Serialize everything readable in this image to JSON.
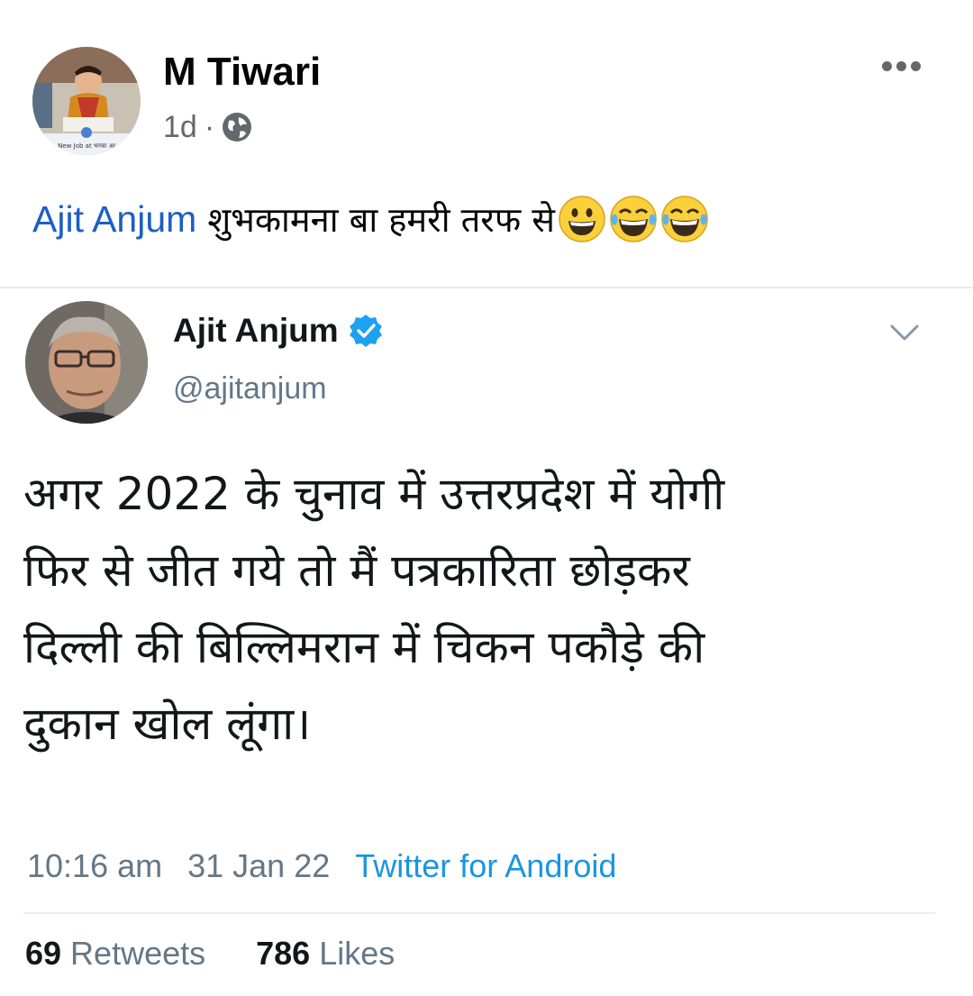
{
  "post": {
    "author_name": "M Tiwari",
    "time": "1d",
    "separator": "·",
    "avatar_banner_text": "New Job at भगवा आ",
    "caption_mention": "Ajit Anjum",
    "caption_text": "शुभकामना बा हमरी तरफ से",
    "caption_emojis": [
      "grinning-face",
      "face-with-tears-of-joy",
      "face-with-tears-of-joy"
    ]
  },
  "tweet": {
    "name": "Ajit Anjum",
    "handle": "@ajitanjum",
    "verified": true,
    "body_lines": [
      "अगर 2022 के चुनाव में उत्तरप्रदेश में योगी",
      "फिर से जीत गये तो मैं पत्रकारिता छोड़कर",
      "दिल्ली की बिल्लिमरान में चिकन पकौड़े की",
      "दुकान खोल लूंगा।"
    ],
    "time": "10:16 am",
    "date": "31 Jan 22",
    "source": "Twitter for Android",
    "retweets_count": "69",
    "retweets_label": "Retweets",
    "likes_count": "786",
    "likes_label": "Likes"
  },
  "colors": {
    "mention": "#1d5fc2",
    "twitter_blue": "#1b95e0",
    "meta_gray": "#657786",
    "fb_gray": "#65676b"
  }
}
